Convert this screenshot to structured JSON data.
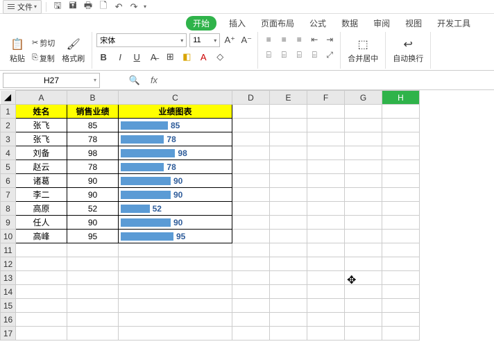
{
  "menubar": {
    "file": "文件"
  },
  "tabs": [
    "开始",
    "插入",
    "页面布局",
    "公式",
    "数据",
    "审阅",
    "视图",
    "开发工具"
  ],
  "active_tab": 0,
  "clipboard": {
    "paste": "粘贴",
    "cut": "剪切",
    "copy": "复制",
    "format_painter": "格式刷"
  },
  "font": {
    "name": "宋体",
    "size": "11"
  },
  "merge_label": "合并居中",
  "wrap_label": "自动换行",
  "namebox": "H27",
  "fx_label": "fx",
  "grid": {
    "cols": [
      "A",
      "B",
      "C",
      "D",
      "E",
      "F",
      "G",
      "H"
    ],
    "col_widths": {
      "A": 74,
      "B": 74,
      "C": 164,
      "D": 54,
      "E": 54,
      "F": 54,
      "G": 54,
      "H": 54
    },
    "selected_col": "H",
    "rows_visible": 17,
    "headers": {
      "A": "姓名",
      "B": "销售业绩",
      "C": "业绩图表"
    },
    "data": [
      {
        "name": "张飞",
        "score": 85
      },
      {
        "name": "张飞",
        "score": 78
      },
      {
        "name": "刘备",
        "score": 98
      },
      {
        "name": "赵云",
        "score": 78
      },
      {
        "name": "诸葛",
        "score": 90
      },
      {
        "name": "李二",
        "score": 90
      },
      {
        "name": "高原",
        "score": 52
      },
      {
        "name": "任人",
        "score": 90
      },
      {
        "name": "高峰",
        "score": 95
      }
    ]
  },
  "chart_data": {
    "type": "bar",
    "title": "业绩图表",
    "xlabel": "",
    "ylabel": "销售业绩",
    "ylim": [
      0,
      100
    ],
    "categories": [
      "张飞",
      "张飞",
      "刘备",
      "赵云",
      "诸葛",
      "李二",
      "高原",
      "任人",
      "高峰"
    ],
    "values": [
      85,
      78,
      98,
      78,
      90,
      90,
      52,
      90,
      95
    ]
  }
}
